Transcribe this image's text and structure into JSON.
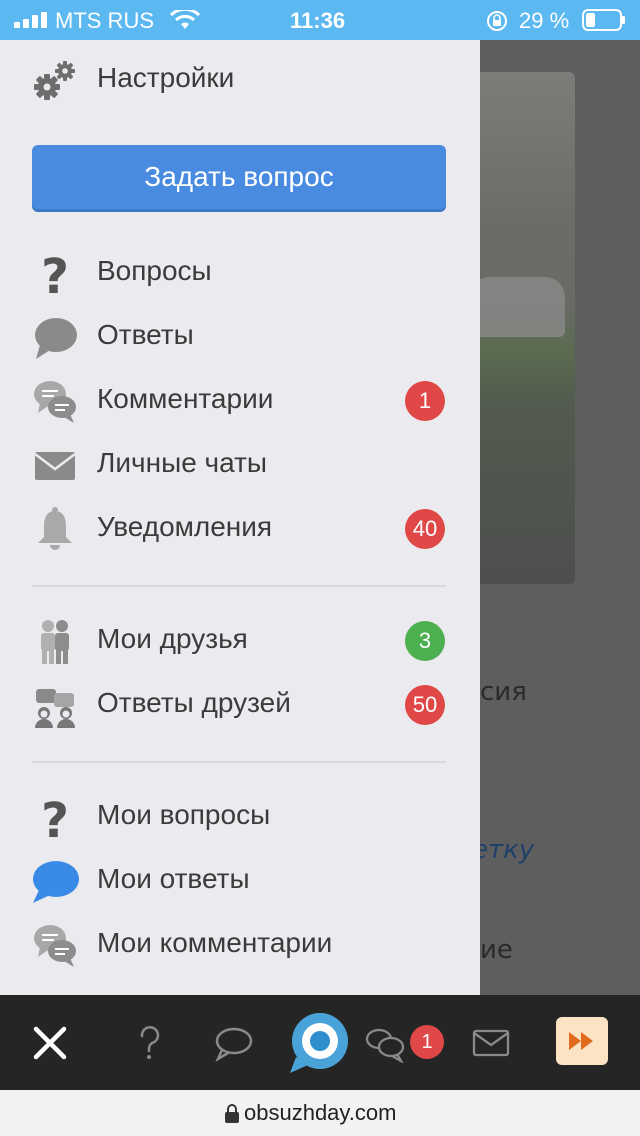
{
  "status_bar": {
    "carrier": "MTS RUS",
    "time": "11:36",
    "battery": "29 %"
  },
  "drawer": {
    "settings_label": "Настройки",
    "ask_button": "Задать вопрос",
    "items": [
      {
        "label": "Вопросы",
        "icon": "question-icon"
      },
      {
        "label": "Ответы",
        "icon": "speech-bubble-icon"
      },
      {
        "label": "Комментарии",
        "icon": "comments-icon",
        "badge": "1"
      },
      {
        "label": "Личные чаты",
        "icon": "envelope-icon"
      },
      {
        "label": "Уведомления",
        "icon": "bell-icon",
        "badge": "40"
      },
      {
        "label": "Мои друзья",
        "icon": "friends-icon",
        "badge": "3"
      },
      {
        "label": "Ответы друзей",
        "icon": "friends-answers-icon",
        "badge": "50"
      },
      {
        "label": "Мои вопросы",
        "icon": "question-icon"
      },
      {
        "label": "Мои ответы",
        "icon": "speech-bubble-icon"
      },
      {
        "label": "Мои комментарии",
        "icon": "comments-icon"
      }
    ]
  },
  "background_page": {
    "text1": "сия",
    "text2": "етку",
    "text3": "ие"
  },
  "toolbar": {
    "chats_badge": "1"
  },
  "url_bar": {
    "url": "obsuzhday.com"
  },
  "colors": {
    "status_bar": "#5bb8f0",
    "ask_button": "#4a8be2",
    "badge_red": "#e04848",
    "badge_green": "#4caf50",
    "toolbar": "#252525",
    "my_answers_icon": "#3a8be6"
  }
}
